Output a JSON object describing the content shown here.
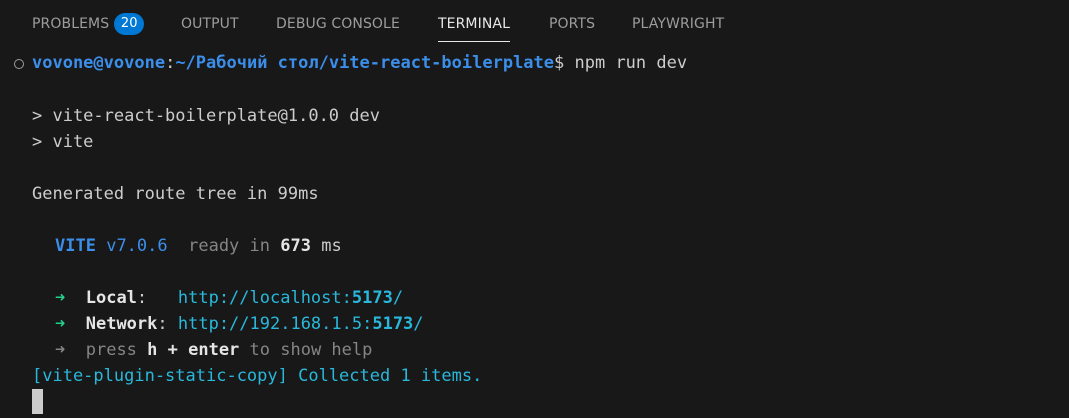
{
  "tabs": [
    {
      "label": "PROBLEMS",
      "badge": "20"
    },
    {
      "label": "OUTPUT"
    },
    {
      "label": "DEBUG CONSOLE"
    },
    {
      "label": "TERMINAL"
    },
    {
      "label": "PORTS"
    },
    {
      "label": "PLAYWRIGHT"
    }
  ],
  "active_tab": "TERMINAL",
  "terminal": {
    "prompt_user": "vovone@vovone",
    "prompt_sep": ":",
    "prompt_path": "~/Рабочий стол/vite-react-boilerplate",
    "prompt_symbol": "$",
    "command": " npm run dev",
    "script_line": "> vite-react-boilerplate@1.0.0 dev",
    "vite_line": "> vite",
    "route_tree": "Generated route tree in 99ms",
    "vite_name": "VITE",
    "vite_version": "v7.0.6",
    "ready_text": "ready in",
    "ready_ms": "673",
    "ready_unit": "ms",
    "arrow": "➜",
    "local_label": "Local",
    "local_url_prefix": "http://localhost:",
    "local_port": "5173",
    "local_url_suffix": "/",
    "network_label": "Network",
    "network_url_prefix": "http://192.168.1.5:",
    "network_port": "5173",
    "network_url_suffix": "/",
    "help_press": "press",
    "help_key": "h + enter",
    "help_rest": "to show help",
    "plugin_line": "[vite-plugin-static-copy] Collected 1 items."
  },
  "colors": {
    "background": "#181818",
    "badge": "#0078d4",
    "prompt": "#3b8eea",
    "url": "#29b8db"
  }
}
